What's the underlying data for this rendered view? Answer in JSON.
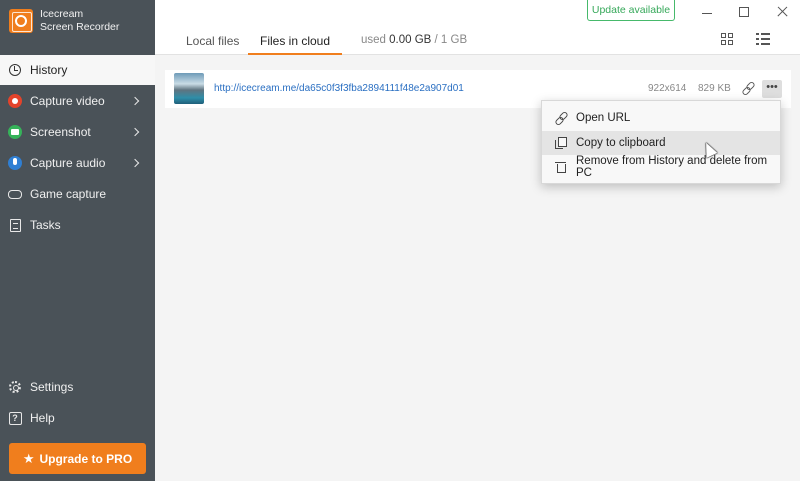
{
  "app": {
    "name_line1": "Icecream",
    "name_line2": "Screen Recorder"
  },
  "sidebar": {
    "items": [
      {
        "label": "History",
        "icon": "history-icon",
        "active": true
      },
      {
        "label": "Capture video",
        "icon": "record-icon",
        "submenu": true
      },
      {
        "label": "Screenshot",
        "icon": "camera-icon",
        "submenu": true
      },
      {
        "label": "Capture audio",
        "icon": "microphone-icon",
        "submenu": true
      },
      {
        "label": "Game capture",
        "icon": "gamepad-icon"
      },
      {
        "label": "Tasks",
        "icon": "tasks-icon"
      }
    ],
    "bottom": [
      {
        "label": "Settings",
        "icon": "gear-icon"
      },
      {
        "label": "Help",
        "icon": "help-icon"
      }
    ],
    "upgrade_label": "Upgrade to PRO"
  },
  "header": {
    "update_label": "Update available",
    "tabs": [
      {
        "label": "Local files",
        "active": false
      },
      {
        "label": "Files in cloud",
        "active": true
      }
    ],
    "usage_prefix": "used ",
    "usage_used": "0.00 GB",
    "usage_total": " / 1 GB"
  },
  "files": [
    {
      "url": "http://icecream.me/da65c0f3f3fba2894111f48e2a907d01",
      "dimensions": "922x614",
      "size": "829 KB"
    }
  ],
  "context_menu": {
    "items": [
      {
        "label": "Open URL",
        "icon": "link-icon"
      },
      {
        "label": "Copy to clipboard",
        "icon": "copy-icon",
        "hovered": true
      },
      {
        "label": "Remove from History and delete from PC",
        "icon": "trash-icon"
      }
    ]
  },
  "colors": {
    "accent": "#f07e1d",
    "sidebar": "#4a5258",
    "update": "#36a85a",
    "link": "#2a6fc2"
  }
}
